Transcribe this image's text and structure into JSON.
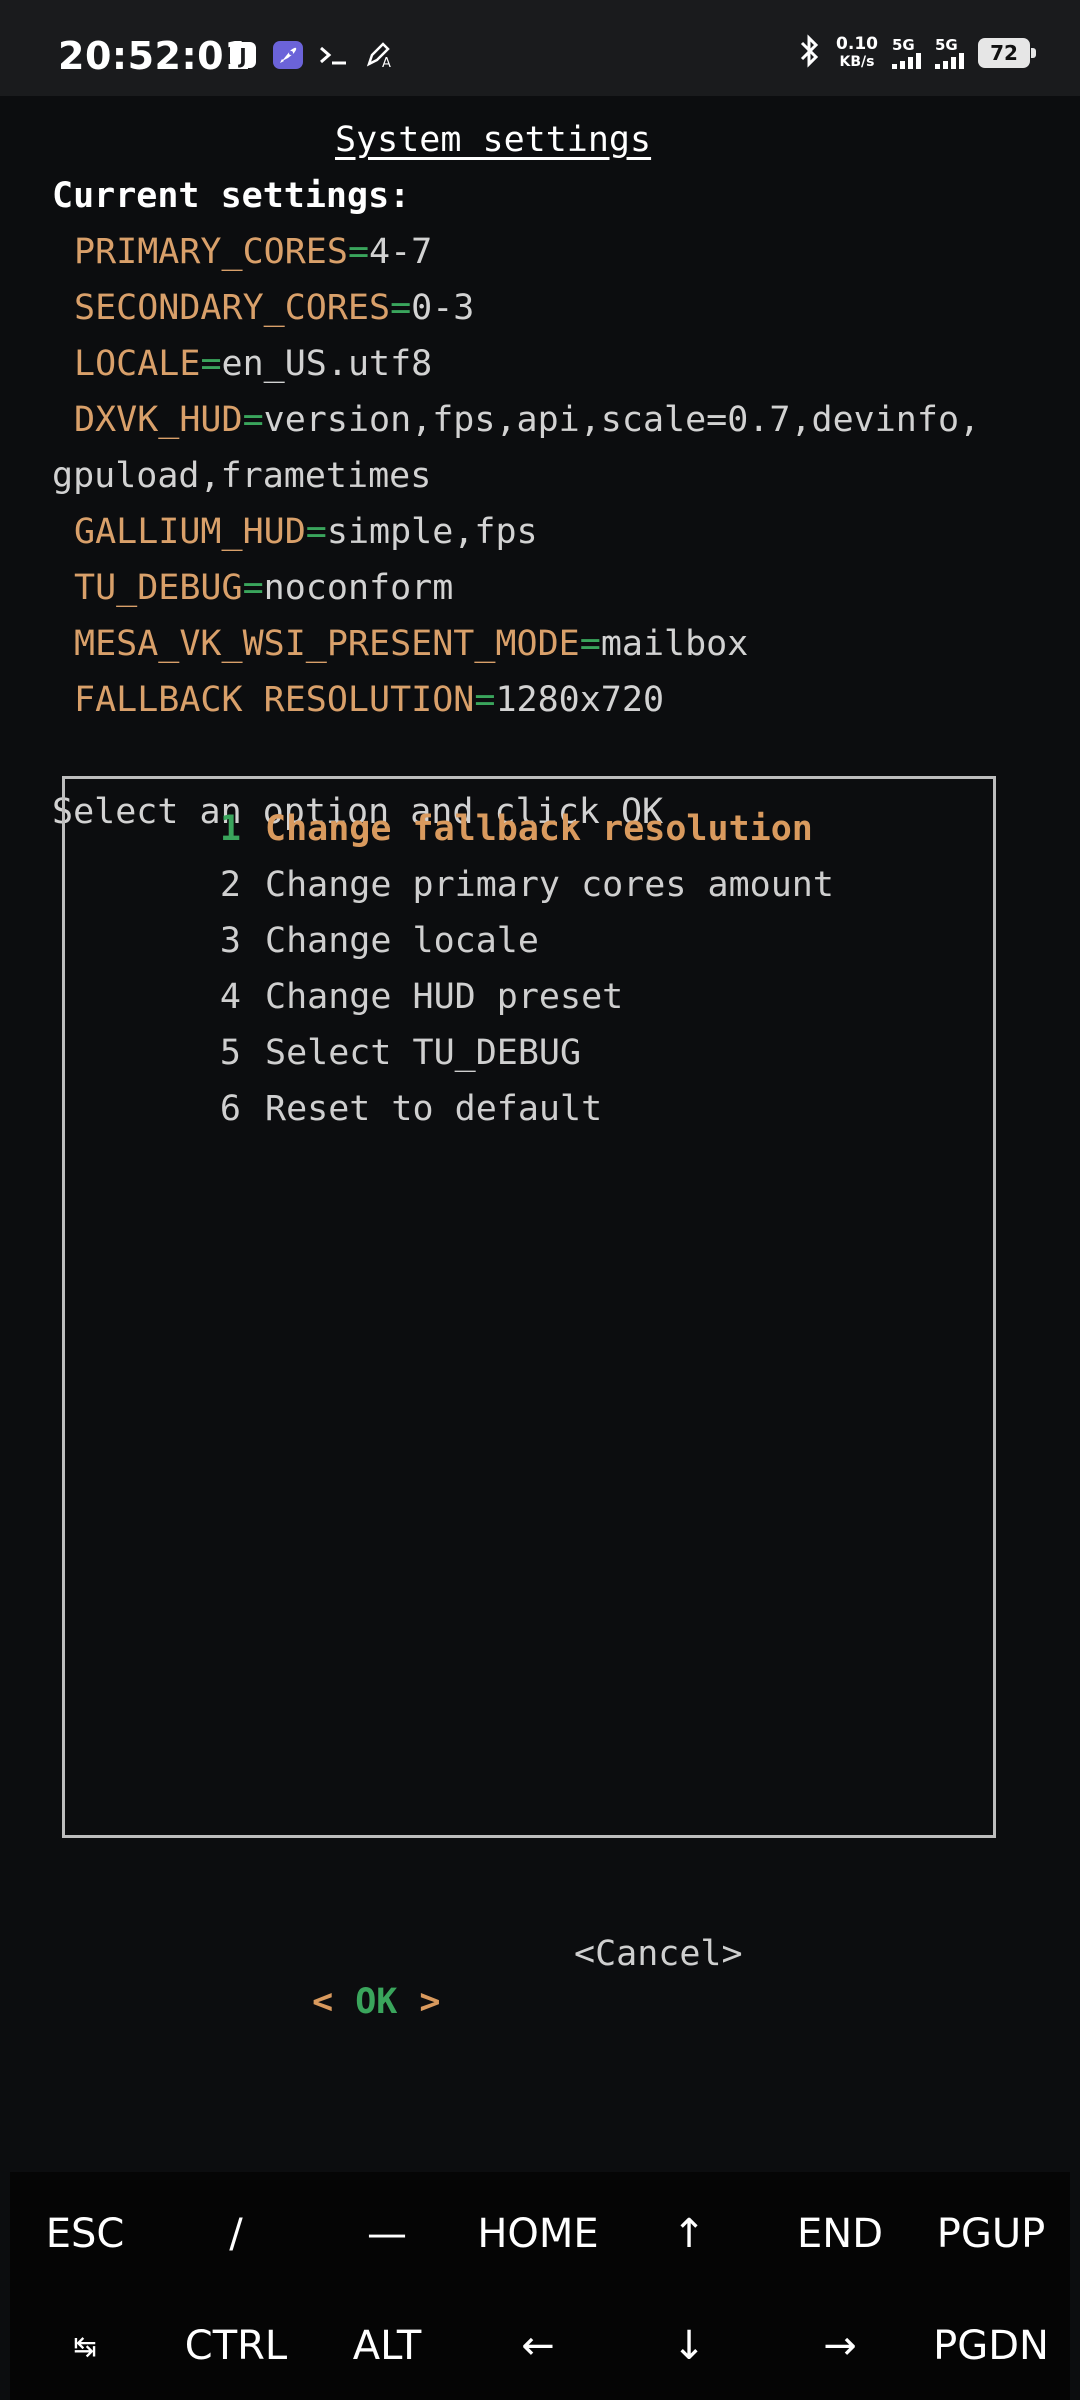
{
  "status_bar": {
    "time": "20:52:01",
    "net_speed_value": "0.10",
    "net_speed_unit": "KB/s",
    "sim1": "5G",
    "sim2": "5G",
    "battery": "72",
    "icons": [
      "j-app-icon",
      "rocket-app-icon",
      "terminal-icon",
      "pen-icon",
      "bluetooth-icon",
      "signal-icon",
      "battery-icon"
    ]
  },
  "dialog": {
    "title": "System settings",
    "heading": "Current settings:",
    "settings": [
      {
        "key": "PRIMARY_CORES",
        "eq": "=",
        "value": "4-7"
      },
      {
        "key": "SECONDARY_CORES",
        "eq": "=",
        "value": "0-3"
      },
      {
        "key": "LOCALE",
        "eq": "=",
        "value": "en_US.utf8"
      },
      {
        "key": "DXVK_HUD",
        "eq": "=",
        "value": "version,fps,api,scale=0.7,devinfo,",
        "value_cont": "gpuload,frametimes"
      },
      {
        "key": "GALLIUM_HUD",
        "eq": "=",
        "value": "simple,fps"
      },
      {
        "key": "TU_DEBUG",
        "eq": "=",
        "value": "noconform"
      },
      {
        "key": "MESA_VK_WSI_PRESENT_MODE",
        "eq": "=",
        "value": "mailbox"
      },
      {
        "key": "FALLBACK RESOLUTION",
        "eq": "=",
        "value": "1280x720"
      }
    ],
    "prompt": "Select an option and click OK",
    "options": [
      {
        "num": "1",
        "label": "Change fallback resolution",
        "selected": true
      },
      {
        "num": "2",
        "label": "Change primary cores amount"
      },
      {
        "num": "3",
        "label": "Change locale"
      },
      {
        "num": "4",
        "label": "Change HUD preset"
      },
      {
        "num": "5",
        "label": "Select TU_DEBUG"
      },
      {
        "num": "6",
        "label": "Reset to default"
      }
    ],
    "ok_left": "<",
    "ok_label": "OK",
    "ok_right": ">",
    "cancel_label": "<Cancel>"
  },
  "extra_keys": {
    "row1": [
      "ESC",
      "/",
      "—",
      "HOME",
      "↑",
      "END",
      "PGUP"
    ],
    "row2": [
      "↹",
      "CTRL",
      "ALT",
      "←",
      "↓",
      "→",
      "PGDN"
    ]
  },
  "colors": {
    "key": "#d9a06a",
    "equals": "#3aa55c",
    "selected": "#d99a5e",
    "background": "#0c0d0f"
  }
}
